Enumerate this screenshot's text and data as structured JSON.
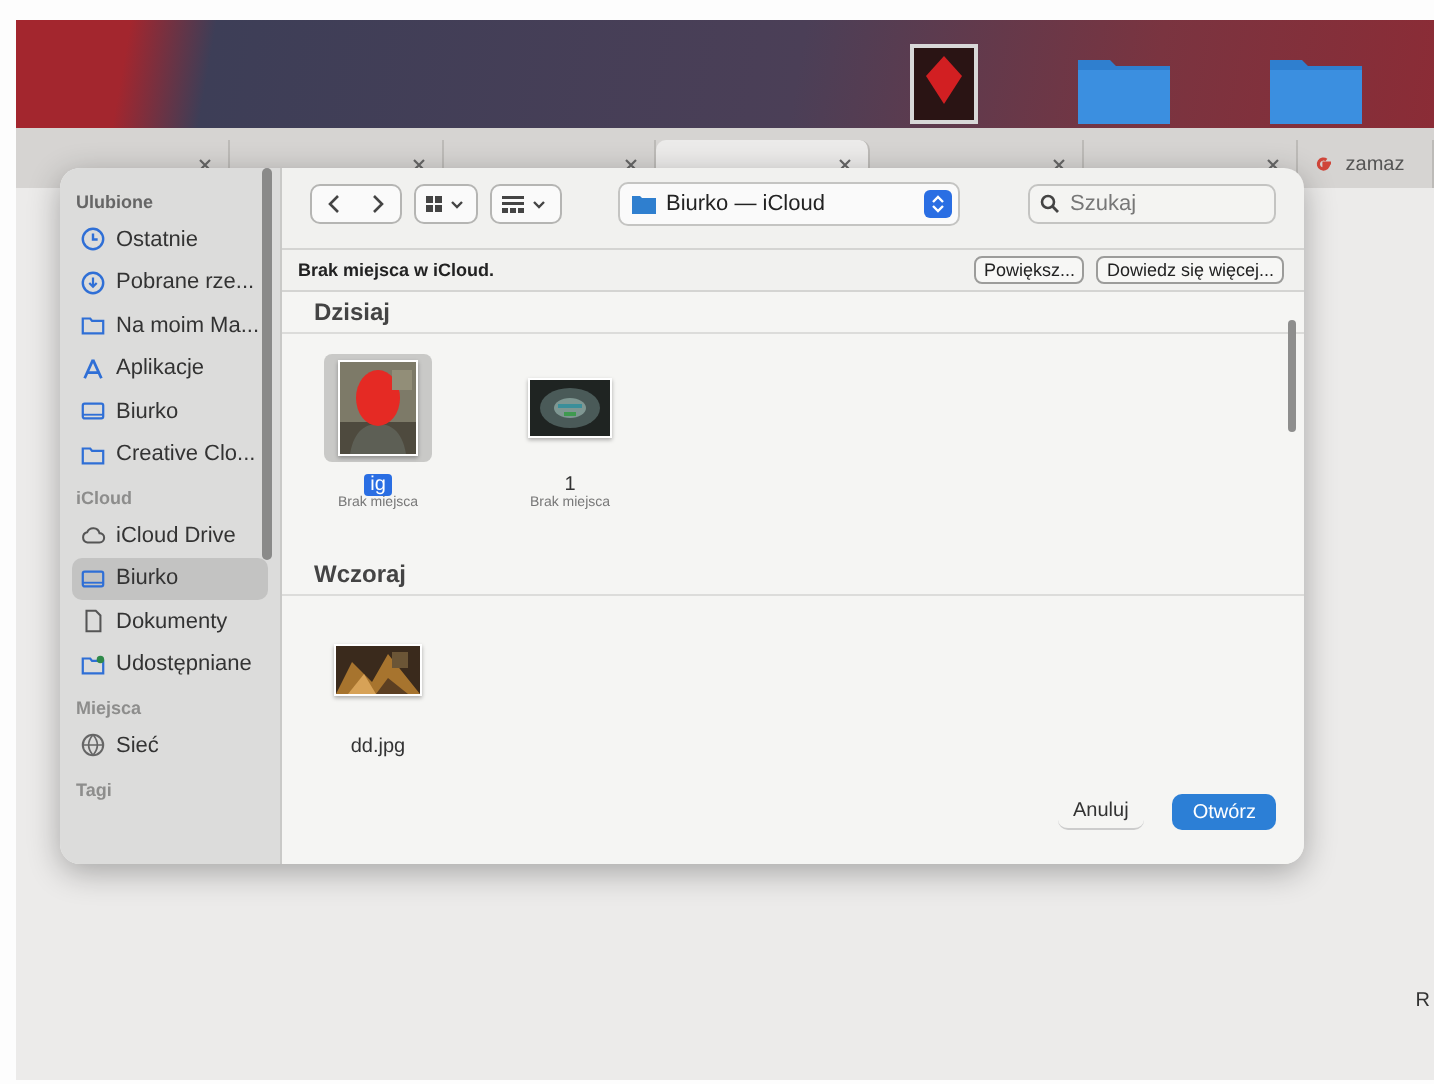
{
  "desktop": {
    "icons": [
      {
        "kind": "picture"
      },
      {
        "kind": "folder"
      },
      {
        "kind": "folder"
      }
    ]
  },
  "browser": {
    "tabs": [
      {
        "selected": false
      },
      {
        "selected": false
      },
      {
        "selected": false
      },
      {
        "selected": true
      },
      {
        "selected": false
      },
      {
        "selected": false
      },
      {
        "label": "zamaz",
        "selected": false
      }
    ],
    "page_text": "R"
  },
  "dialog": {
    "sidebar": [
      {
        "title": "Ulubione",
        "items": [
          {
            "label": "Ostatnie",
            "kind": "clock",
            "selected": false
          },
          {
            "label": "Pobrane rze...",
            "kind": "download",
            "selected": false
          },
          {
            "label": "Na moim Ma...",
            "kind": "folder",
            "selected": false
          },
          {
            "label": "Aplikacje",
            "kind": "apps",
            "selected": false
          },
          {
            "label": "Biurko",
            "kind": "desktop",
            "selected": false
          },
          {
            "label": "Creative Clo...",
            "kind": "folder",
            "selected": false
          }
        ]
      },
      {
        "title": "iCloud",
        "items": [
          {
            "label": "iCloud Drive",
            "kind": "cloud",
            "selected": false
          },
          {
            "label": "Biurko",
            "kind": "desktop",
            "selected": true
          },
          {
            "label": "Dokumenty",
            "kind": "doc",
            "selected": false
          },
          {
            "label": "Udostępniane",
            "kind": "shared",
            "selected": false
          }
        ]
      },
      {
        "title": "Miejsca",
        "items": [
          {
            "label": "Sieć",
            "kind": "globe",
            "selected": false
          }
        ]
      },
      {
        "title": "Tagi"
      }
    ],
    "location": "Biurko — iCloud",
    "search": {
      "placeholder": "Szukaj"
    },
    "banner": {
      "text": "Brak miejsca w iCloud.",
      "buttons": [
        "Powiększ...",
        "Dowiedz się więcej..."
      ]
    },
    "groups": [
      {
        "title": "Dzisiaj",
        "files": [
          {
            "name": "ig",
            "status": "Brak miejsca",
            "selected": true,
            "kind": "portrait"
          },
          {
            "name": "1",
            "status": "Brak miejsca",
            "selected": false,
            "kind": "dark"
          }
        ]
      },
      {
        "title": "Wczoraj",
        "files": [
          {
            "name": "dd.jpg",
            "selected": false,
            "kind": "warm"
          }
        ]
      }
    ],
    "buttons": [
      {
        "label": "Anuluj",
        "kind": "secondary"
      },
      {
        "label": "Otwórz",
        "kind": "primary"
      }
    ]
  }
}
